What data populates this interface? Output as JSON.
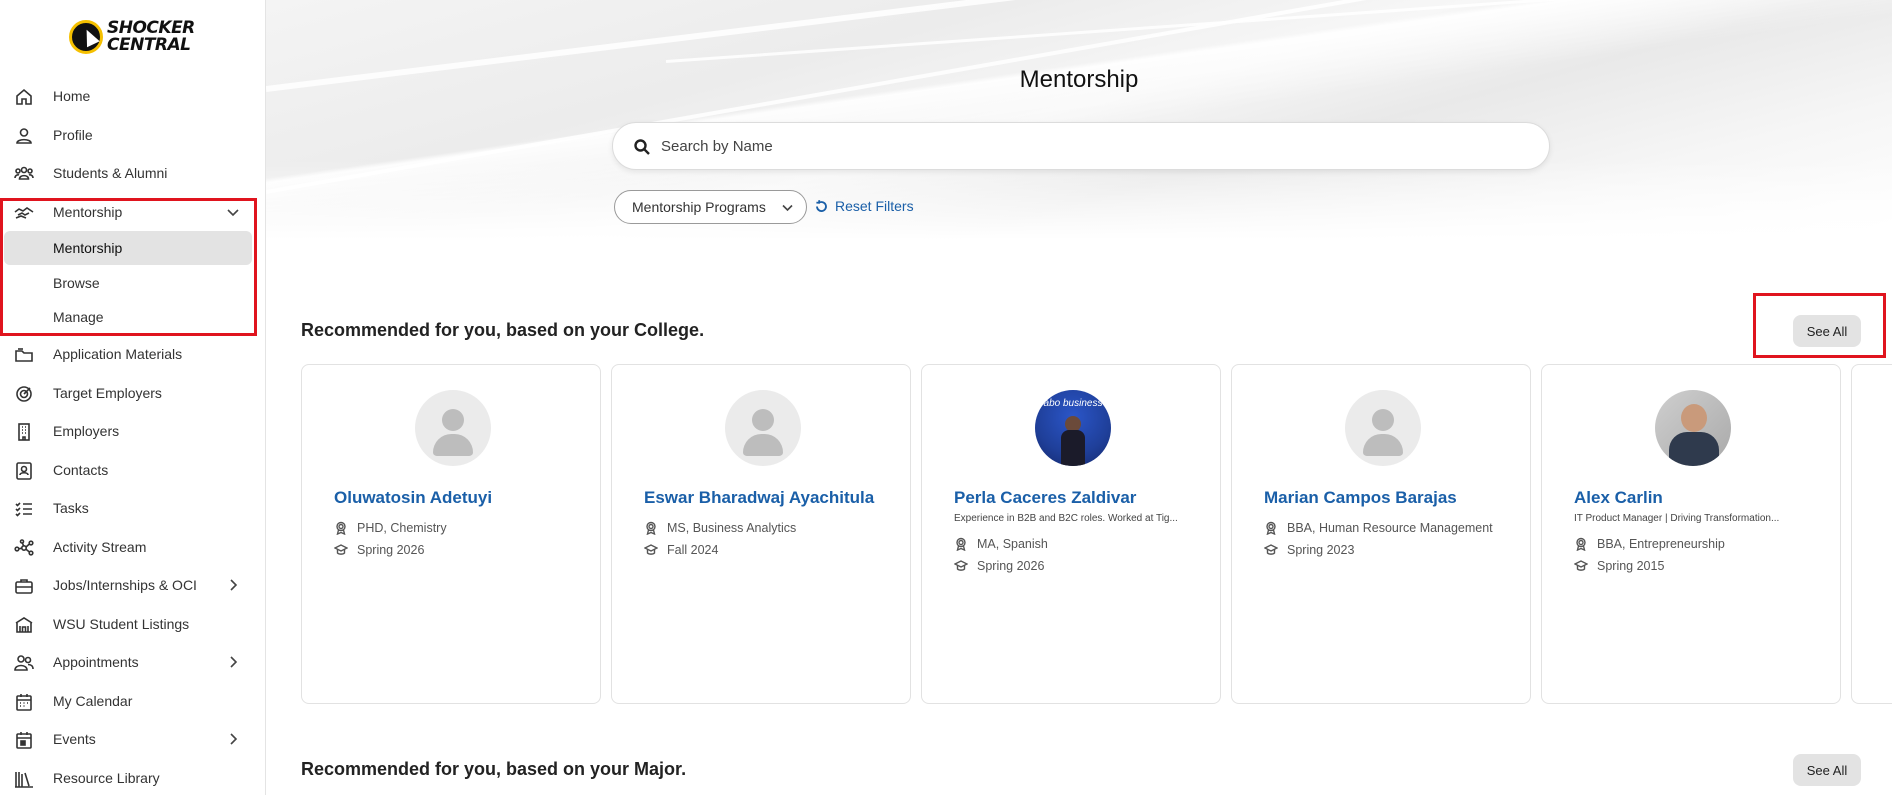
{
  "app": {
    "logo_line1": "SHOCKER",
    "logo_line2": "CENTRAL"
  },
  "sidebar": {
    "items": [
      {
        "label": "Home",
        "icon": "home-icon"
      },
      {
        "label": "Profile",
        "icon": "user-icon"
      },
      {
        "label": "Students & Alumni",
        "icon": "users-icon"
      },
      {
        "label": "Mentorship",
        "icon": "handshake-icon",
        "expanded": true
      },
      {
        "label": "Application Materials",
        "icon": "folder-icon"
      },
      {
        "label": "Target Employers",
        "icon": "target-icon"
      },
      {
        "label": "Employers",
        "icon": "building-icon"
      },
      {
        "label": "Contacts",
        "icon": "contact-card-icon"
      },
      {
        "label": "Tasks",
        "icon": "checklist-icon"
      },
      {
        "label": "Activity Stream",
        "icon": "network-icon"
      },
      {
        "label": "Jobs/Internships & OCI",
        "icon": "briefcase-icon"
      },
      {
        "label": "WSU Student Listings",
        "icon": "school-icon"
      },
      {
        "label": "Appointments",
        "icon": "people-icon"
      },
      {
        "label": "My Calendar",
        "icon": "calendar-icon"
      },
      {
        "label": "Events",
        "icon": "event-icon"
      },
      {
        "label": "Resource Library",
        "icon": "library-icon"
      }
    ],
    "mentorship_sub": [
      {
        "label": "Mentorship",
        "active": true
      },
      {
        "label": "Browse",
        "active": false
      },
      {
        "label": "Manage",
        "active": false
      }
    ]
  },
  "main": {
    "title": "Mentorship",
    "search_placeholder": "Search by Name",
    "filter_label": "Mentorship Programs",
    "reset_label": "Reset Filters",
    "see_all_label": "See All",
    "sections": [
      {
        "title": "Recommended for you, based on your College."
      },
      {
        "title": "Recommended for you, based on your Major."
      }
    ],
    "mentors": [
      {
        "name": "Oluwatosin Adetuyi",
        "tagline": "",
        "degree": "PHD, Chemistry",
        "term": "Spring 2026"
      },
      {
        "name": "Eswar Bharadwaj Ayachitula",
        "tagline": "",
        "degree": "MS, Business Analytics",
        "term": "Fall 2024"
      },
      {
        "name": "Perla Caceres Zaldivar",
        "tagline": "Experience in B2B and B2C roles. Worked at Tig...",
        "degree": "MA, Spanish",
        "term": "Spring 2026",
        "photo_text": "abo business"
      },
      {
        "name": "Marian Campos Barajas",
        "tagline": "",
        "degree": "BBA, Human Resource Management",
        "term": "Spring 2023"
      },
      {
        "name": "Alex Carlin",
        "tagline": "IT Product Manager | Driving Transformation...",
        "degree": "BBA, Entrepreneurship",
        "term": "Spring 2015"
      }
    ]
  },
  "colors": {
    "link_blue": "#1a5fa8",
    "highlight_red": "#e0141e",
    "active_bg": "#e3e3e3"
  }
}
